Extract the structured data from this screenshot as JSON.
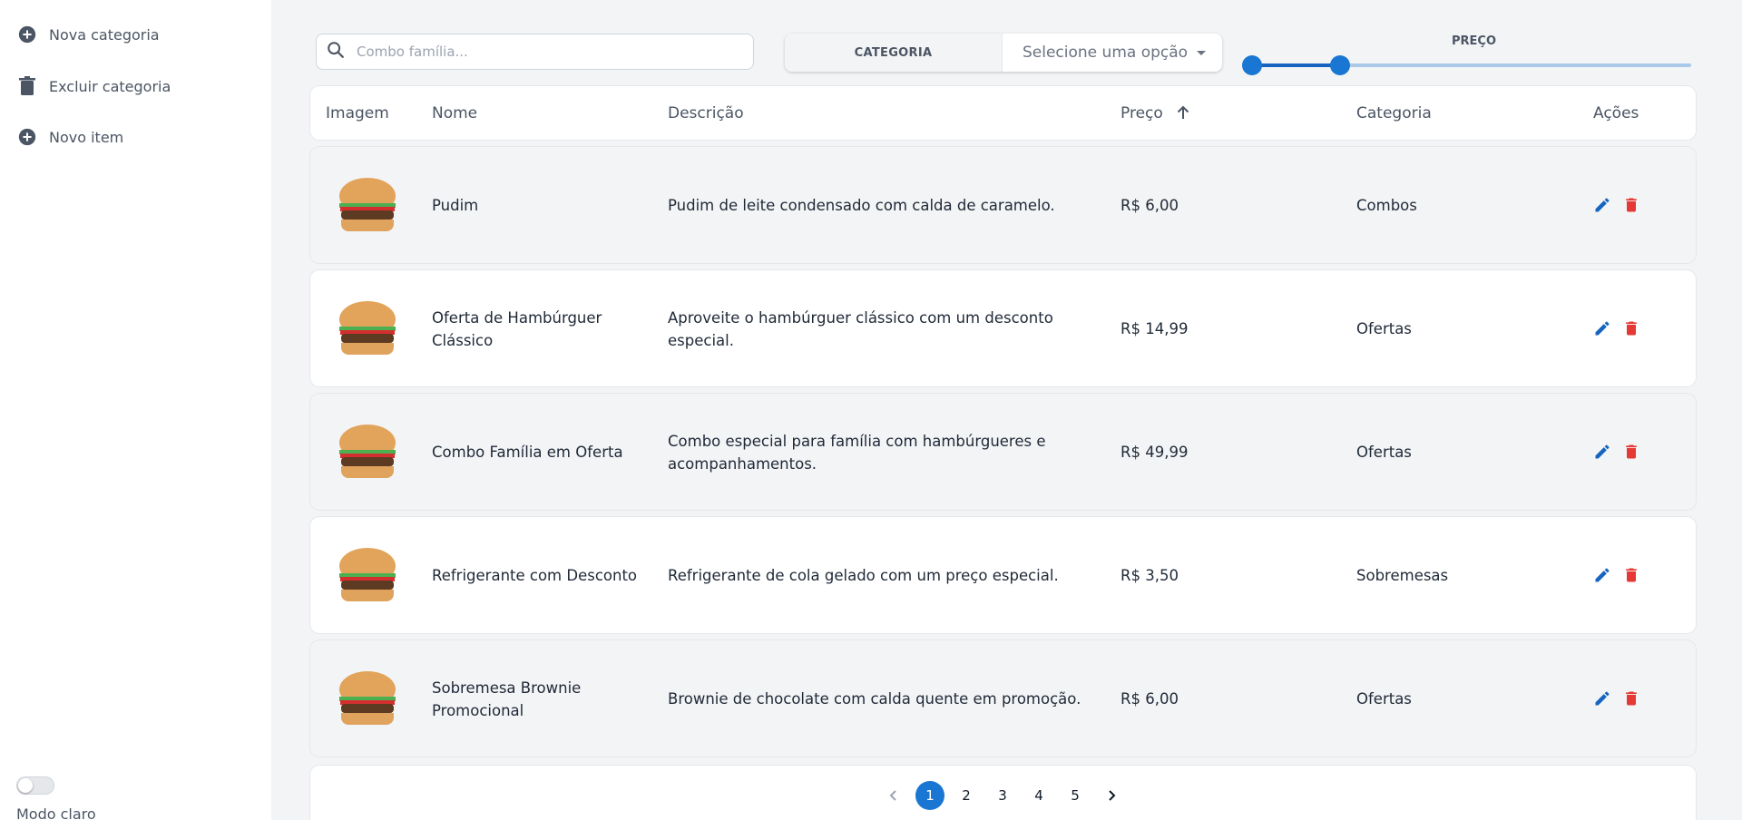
{
  "sidebar": {
    "items": [
      {
        "label": "Nova categoria",
        "icon": "add-circle-icon"
      },
      {
        "label": "Excluir categoria",
        "icon": "trash-icon"
      },
      {
        "label": "Novo item",
        "icon": "add-circle-icon"
      }
    ],
    "mode_label": "Modo claro",
    "mode_toggle_on": false
  },
  "filters": {
    "search_placeholder": "Combo família...",
    "category_label": "CATEGORIA",
    "category_select": "Selecione uma opção",
    "price_label": "PREÇO"
  },
  "table": {
    "headers": [
      "Imagem",
      "Nome",
      "Descrição",
      "Preço",
      "Categoria",
      "Ações"
    ],
    "sorted_column": "Preço",
    "sort_direction": "asc",
    "rows": [
      {
        "name": "Pudim",
        "description": "Pudim de leite condensado com calda de caramelo.",
        "price": "R$ 6,00",
        "category": "Combos"
      },
      {
        "name": "Oferta de Hambúrguer Clássico",
        "description": "Aproveite o hambúrguer clássico com um desconto especial.",
        "price": "R$ 14,99",
        "category": "Ofertas"
      },
      {
        "name": "Combo Família em Oferta",
        "description": "Combo especial para família com hambúrgueres e acompanhamentos.",
        "price": "R$ 49,99",
        "category": "Ofertas"
      },
      {
        "name": "Refrigerante com Desconto",
        "description": "Refrigerante de cola gelado com um preço especial.",
        "price": "R$ 3,50",
        "category": "Sobremesas"
      },
      {
        "name": "Sobremesa Brownie Promocional",
        "description": "Brownie de chocolate com calda quente em promoção.",
        "price": "R$ 6,00",
        "category": "Ofertas"
      }
    ]
  },
  "pagination": {
    "pages": [
      "1",
      "2",
      "3",
      "4",
      "5"
    ],
    "current": "1"
  },
  "colors": {
    "accent": "#1976d2",
    "edit": "#1565c0",
    "delete": "#e53935"
  }
}
